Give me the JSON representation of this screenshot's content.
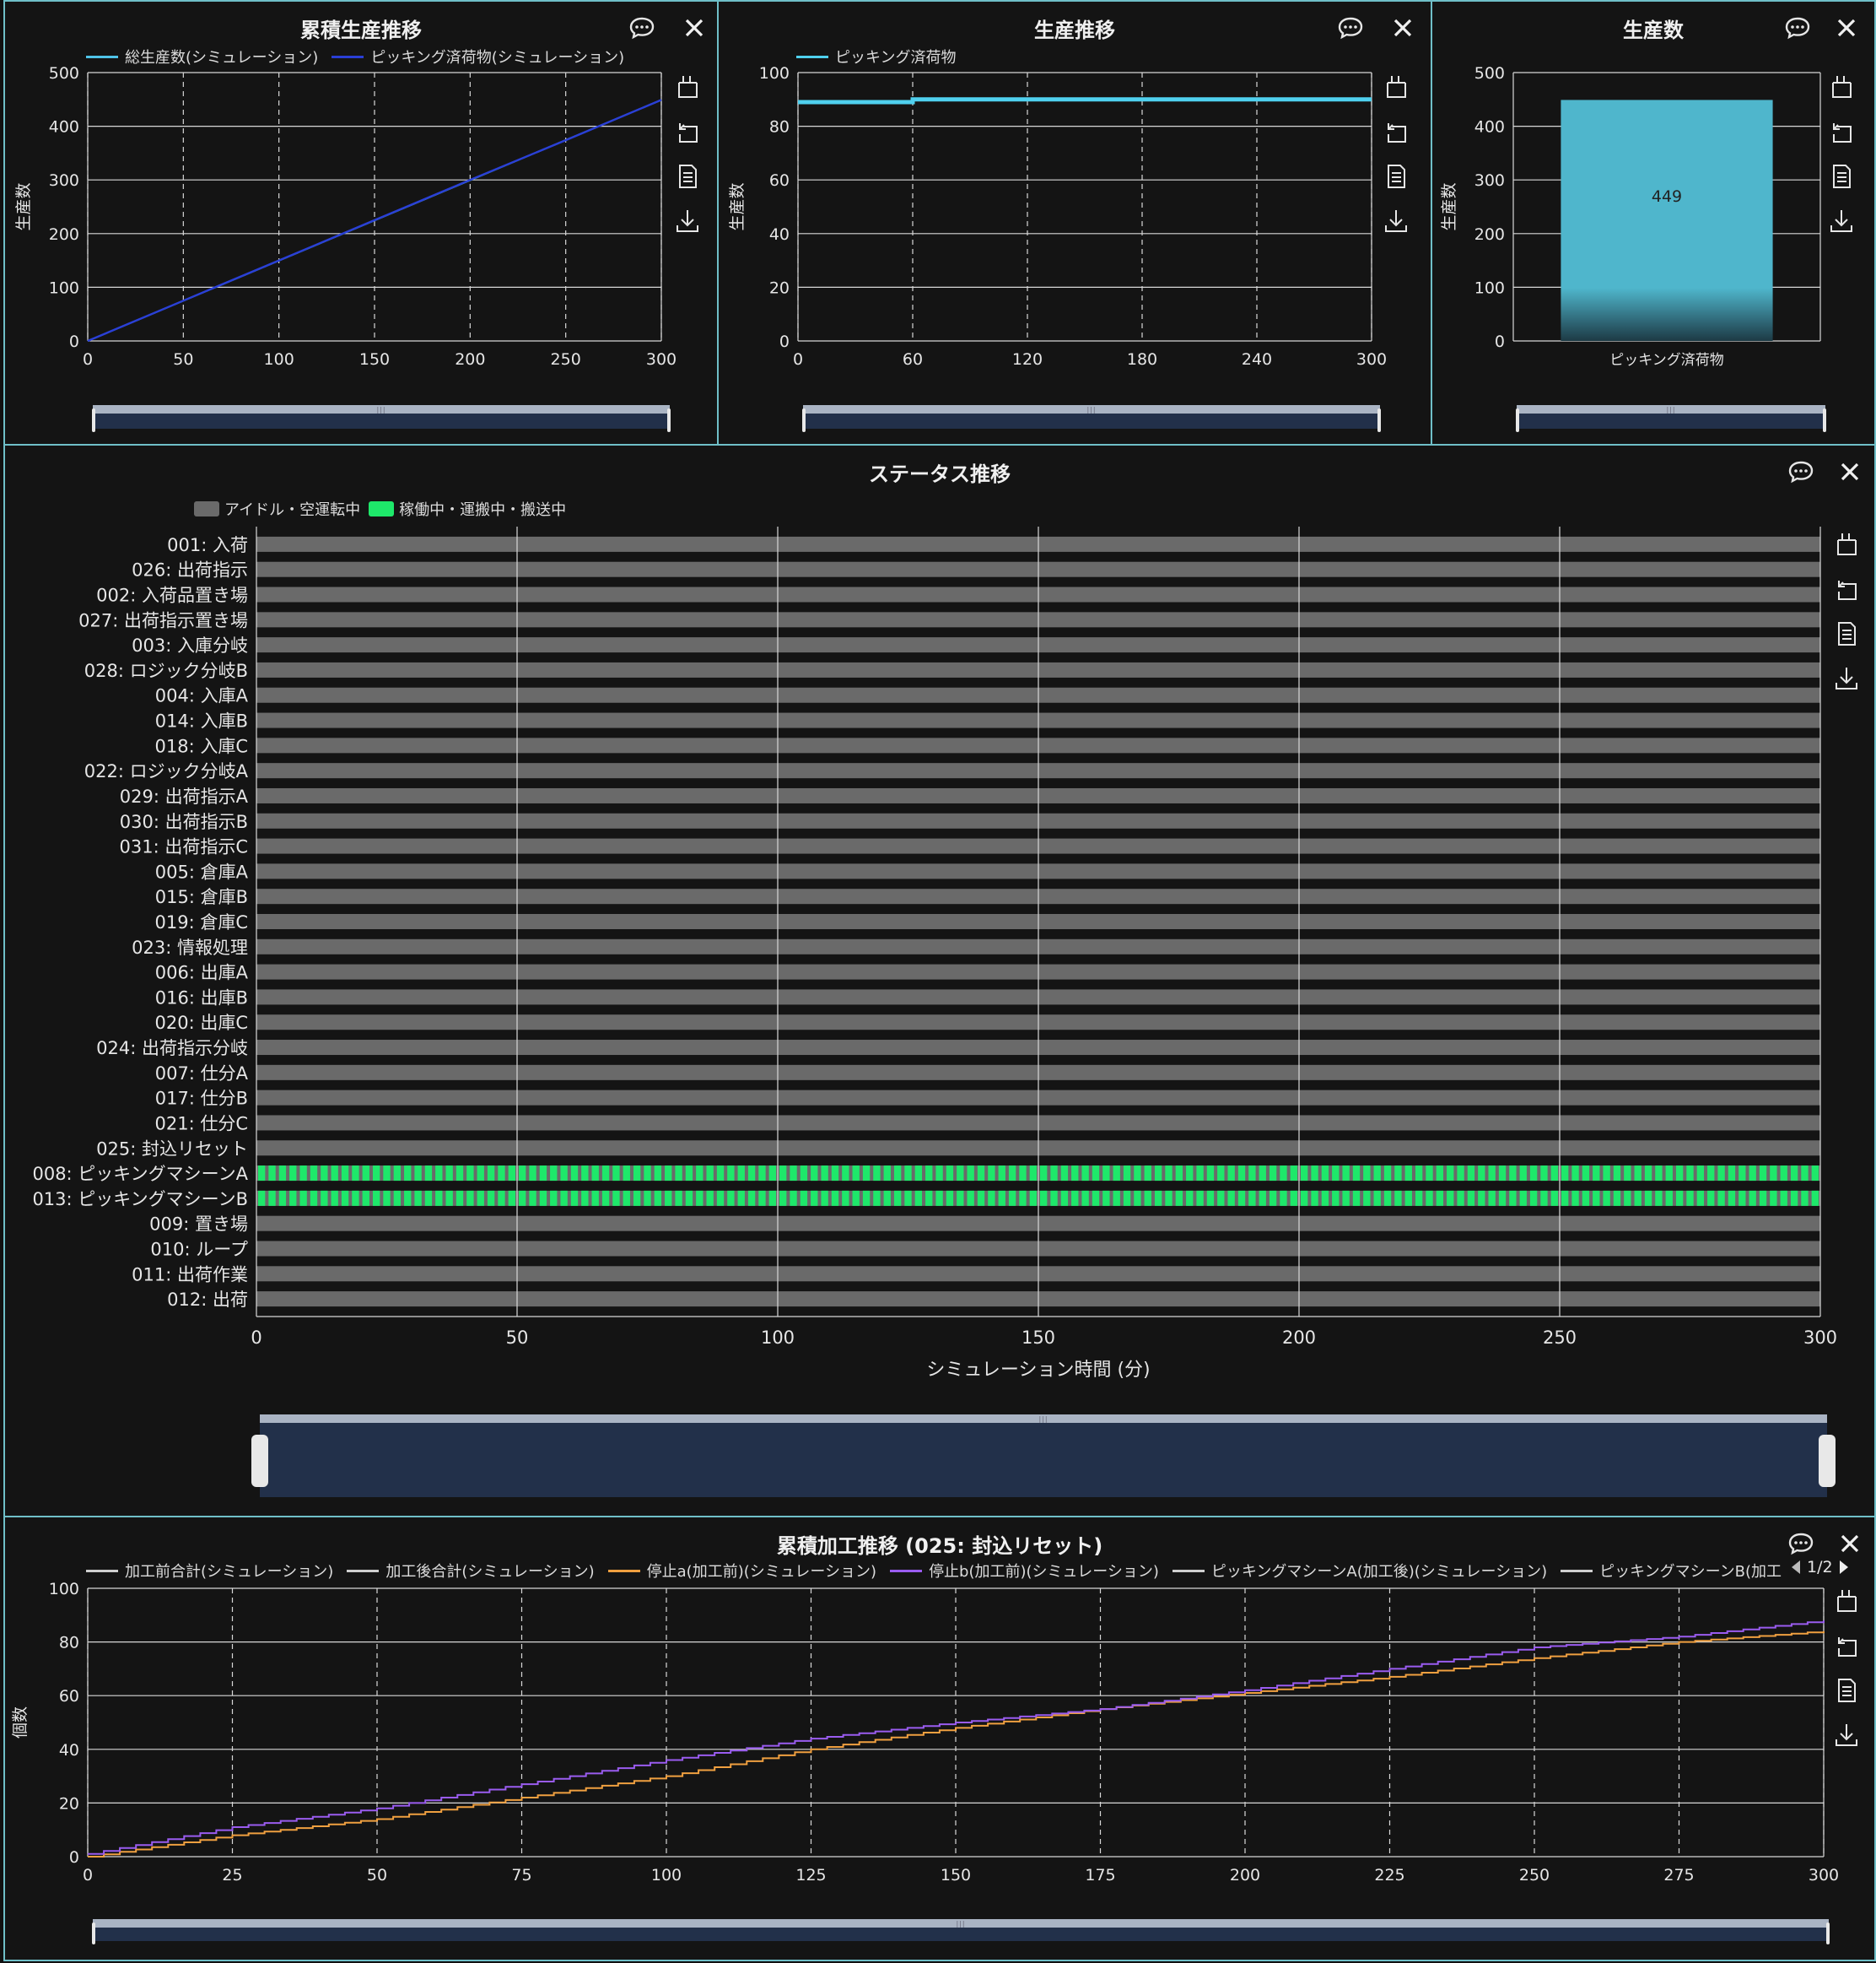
{
  "panels": {
    "cumulative": {
      "title": "累積生産推移",
      "legend": [
        {
          "name": "総生産数(シミュレーション)",
          "color": "#4fc3e8"
        },
        {
          "name": "ピッキング済荷物(シミュレーション)",
          "color": "#2a3fd6"
        }
      ],
      "ylabel": "生産数"
    },
    "production": {
      "title": "生産推移",
      "legend": [
        {
          "name": "ピッキング済荷物",
          "color": "#4fd0ee"
        }
      ],
      "ylabel": "生産数"
    },
    "count": {
      "title": "生産数",
      "ylabel": "生産数"
    },
    "status": {
      "title": "ステータス推移",
      "legend": [
        {
          "name": "アイドル・空運転中",
          "color": "#6a6a6a"
        },
        {
          "name": "稼働中・運搬中・搬送中",
          "color": "#1ee86a"
        }
      ],
      "xlabel": "シミュレーション時間 (分)"
    },
    "processing": {
      "title": "累積加工推移 (025: 封込リセット)",
      "legend": [
        {
          "name": "加工前合計(シミュレーション)",
          "color": "#cfcfcf"
        },
        {
          "name": "加工後合計(シミュレーション)",
          "color": "#cfcfcf"
        },
        {
          "name": "停止a(加工前)(シミュレーション)",
          "color": "#f0a040"
        },
        {
          "name": "停止b(加工前)(シミュレーション)",
          "color": "#9a5cf0"
        },
        {
          "name": "ピッキングマシーンA(加工後)(シミュレーション)",
          "color": "#cfcfcf"
        },
        {
          "name": "ピッキングマシーンB(加工",
          "color": "#cfcfcf"
        }
      ],
      "pager": "1/2",
      "ylabel": "個数"
    }
  },
  "chart_data": [
    {
      "type": "line",
      "title": "累積生産推移",
      "xlabel": "",
      "ylabel": "生産数",
      "xlim": [
        0,
        300
      ],
      "ylim": [
        0,
        500
      ],
      "xticks": [
        0,
        50,
        100,
        150,
        200,
        250,
        300
      ],
      "yticks": [
        0,
        100,
        200,
        300,
        400,
        500
      ],
      "grid": true,
      "series": [
        {
          "name": "総生産数(シミュレーション)",
          "x": [
            0,
            300
          ],
          "y": [
            0,
            449
          ]
        },
        {
          "name": "ピッキング済荷物(シミュレーション)",
          "x": [
            0,
            50,
            100,
            150,
            200,
            250,
            300
          ],
          "y": [
            0,
            75,
            150,
            225,
            300,
            374,
            449
          ]
        }
      ]
    },
    {
      "type": "line",
      "title": "生産推移",
      "xlabel": "",
      "ylabel": "生産数",
      "xlim": [
        0,
        300
      ],
      "ylim": [
        0,
        100
      ],
      "xticks": [
        0,
        60,
        120,
        180,
        240,
        300
      ],
      "yticks": [
        0,
        20,
        40,
        60,
        80,
        100
      ],
      "grid": true,
      "series": [
        {
          "name": "ピッキング済荷物",
          "x": [
            0,
            60,
            60,
            300
          ],
          "y": [
            89,
            89,
            90,
            90
          ]
        }
      ]
    },
    {
      "type": "bar",
      "title": "生産数",
      "ylabel": "生産数",
      "categories": [
        "ピッキング済荷物"
      ],
      "values": [
        449
      ],
      "ylim": [
        0,
        500
      ],
      "yticks": [
        0,
        100,
        200,
        300,
        400,
        500
      ],
      "data_labels": [
        "449"
      ]
    },
    {
      "type": "heatmap",
      "title": "ステータス推移",
      "xlabel": "シミュレーション時間 (分)",
      "xlim": [
        0,
        300
      ],
      "xticks": [
        0,
        50,
        100,
        150,
        200,
        250,
        300
      ],
      "rows": [
        {
          "label": "001: 入荷",
          "state": "idle"
        },
        {
          "label": "026: 出荷指示",
          "state": "idle"
        },
        {
          "label": "002: 入荷品置き場",
          "state": "idle"
        },
        {
          "label": "027: 出荷指示置き場",
          "state": "idle"
        },
        {
          "label": "003: 入庫分岐",
          "state": "idle"
        },
        {
          "label": "028: ロジック分岐B",
          "state": "idle"
        },
        {
          "label": "004: 入庫A",
          "state": "idle"
        },
        {
          "label": "014: 入庫B",
          "state": "idle"
        },
        {
          "label": "018: 入庫C",
          "state": "idle"
        },
        {
          "label": "022: ロジック分岐A",
          "state": "idle"
        },
        {
          "label": "029: 出荷指示A",
          "state": "idle"
        },
        {
          "label": "030: 出荷指示B",
          "state": "idle"
        },
        {
          "label": "031: 出荷指示C",
          "state": "idle"
        },
        {
          "label": "005: 倉庫A",
          "state": "idle"
        },
        {
          "label": "015: 倉庫B",
          "state": "idle"
        },
        {
          "label": "019: 倉庫C",
          "state": "idle"
        },
        {
          "label": "023: 情報処理",
          "state": "idle"
        },
        {
          "label": "006: 出庫A",
          "state": "idle"
        },
        {
          "label": "016: 出庫B",
          "state": "idle"
        },
        {
          "label": "020: 出庫C",
          "state": "idle"
        },
        {
          "label": "024: 出荷指示分岐",
          "state": "idle"
        },
        {
          "label": "007: 仕分A",
          "state": "idle"
        },
        {
          "label": "017: 仕分B",
          "state": "idle"
        },
        {
          "label": "021: 仕分C",
          "state": "idle"
        },
        {
          "label": "025: 封込リセット",
          "state": "idle"
        },
        {
          "label": "008: ピッキングマシーンA",
          "state": "active"
        },
        {
          "label": "013: ピッキングマシーンB",
          "state": "active"
        },
        {
          "label": "009: 置き場",
          "state": "idle"
        },
        {
          "label": "010: ループ",
          "state": "idle"
        },
        {
          "label": "011: 出荷作業",
          "state": "idle"
        },
        {
          "label": "012: 出荷",
          "state": "idle"
        }
      ],
      "legend": [
        "アイドル・空運転中",
        "稼働中・運搬中・搬送中"
      ]
    },
    {
      "type": "line",
      "title": "累積加工推移 (025: 封込リセット)",
      "xlabel": "",
      "ylabel": "個数",
      "xlim": [
        0,
        300
      ],
      "ylim": [
        0,
        100
      ],
      "xticks": [
        0,
        25,
        50,
        75,
        100,
        125,
        150,
        175,
        200,
        225,
        250,
        275,
        300
      ],
      "yticks": [
        0,
        20,
        40,
        60,
        80,
        100
      ],
      "grid": true,
      "series": [
        {
          "name": "停止a(加工前)(シミュレーション)",
          "x": [
            0,
            25,
            50,
            75,
            100,
            125,
            150,
            175,
            200,
            225,
            250,
            275,
            300
          ],
          "y": [
            0,
            8,
            14,
            22,
            30,
            40,
            48,
            55,
            61,
            67,
            74,
            80,
            84
          ]
        },
        {
          "name": "停止b(加工前)(シミュレーション)",
          "x": [
            0,
            25,
            50,
            75,
            100,
            125,
            150,
            175,
            200,
            225,
            250,
            275,
            300
          ],
          "y": [
            1,
            11,
            18,
            27,
            36,
            44,
            50,
            55,
            62,
            70,
            78,
            82,
            88
          ]
        }
      ]
    }
  ]
}
